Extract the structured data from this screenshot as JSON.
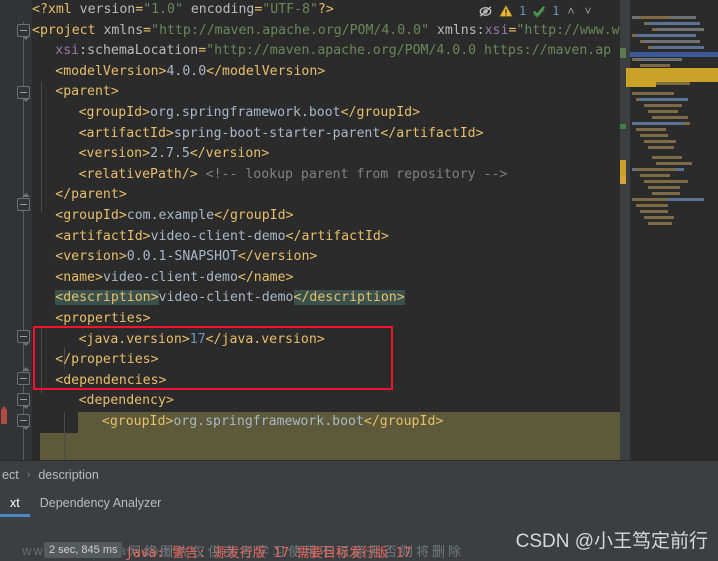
{
  "app": {
    "theme_bg": "#2b2b2b",
    "accent": "#4a88c7",
    "annotation_color": "#f4142e",
    "selection_color": "#5c5a3a"
  },
  "inspector": {
    "eye_off_icon": "inspection-disabled-icon",
    "warning_icon": "warning-triangle-icon",
    "warning_count": "1",
    "check_icon": "green-check-icon",
    "check_count": "1",
    "prev_label": "˄",
    "next_label": "˅"
  },
  "editor": {
    "language": "xml",
    "file": "pom.xml",
    "lines": [
      {
        "indent": 0,
        "html": "<span class=\"pi\">&lt;?</span><span class=\"pi\">xml </span><span class=\"attr\">version</span><span class=\"pi\">=</span><span class=\"attrv\">\"1.0\"</span><span class=\"pi\"> </span><span class=\"attr\">encoding</span><span class=\"pi\">=</span><span class=\"attrv\">\"UTF-8\"</span><span class=\"pi\">?&gt;</span>"
      },
      {
        "indent": 0,
        "html": "<span class=\"tag\">&lt;project </span><span class=\"attr\">xmlns</span><span class=\"tag\">=</span><span class=\"attrv\">\"http://maven.apache.org/POM/4.0.0\"</span><span class=\"tag\"> </span><span class=\"attr\">xmlns:</span><span class=\"ns\">xsi</span><span class=\"tag\">=</span><span class=\"attrv\">\"http://www.w</span>"
      },
      {
        "indent": 1,
        "html": "<span class=\"ns\">xsi</span><span class=\"attr\">:schemaLocation</span><span class=\"tag\">=</span><span class=\"attrv\">\"http://maven.apache.org/POM/4.0.0 https://maven.ap</span>"
      },
      {
        "indent": 1,
        "html": "<span class=\"tag\">&lt;modelVersion&gt;</span><span class=\"val\">4.0.0</span><span class=\"tag\">&lt;/modelVersion&gt;</span>"
      },
      {
        "indent": 1,
        "html": "<span class=\"tag\">&lt;parent&gt;</span>"
      },
      {
        "indent": 2,
        "html": "<span class=\"tag\">&lt;groupId&gt;</span><span class=\"val\">org.springframework.boot</span><span class=\"tag\">&lt;/groupId&gt;</span>"
      },
      {
        "indent": 2,
        "html": "<span class=\"tag\">&lt;artifactId&gt;</span><span class=\"val\">spring-boot-starter-parent</span><span class=\"tag\">&lt;/artifactId&gt;</span>"
      },
      {
        "indent": 2,
        "html": "<span class=\"tag\">&lt;version&gt;</span><span class=\"val\">2.7.5</span><span class=\"tag\">&lt;/version&gt;</span>"
      },
      {
        "indent": 2,
        "html": "<span class=\"tag\">&lt;relativePath/&gt;</span><span class=\"cmt\"> &lt;!-- lookup parent from repository --&gt;</span>"
      },
      {
        "indent": 1,
        "html": "<span class=\"tag\">&lt;/parent&gt;</span>"
      },
      {
        "indent": 1,
        "html": "<span class=\"tag\">&lt;groupId&gt;</span><span class=\"val\">com.example</span><span class=\"tag\">&lt;/groupId&gt;</span>"
      },
      {
        "indent": 1,
        "html": "<span class=\"tag\">&lt;artifactId&gt;</span><span class=\"val\">video-client-demo</span><span class=\"tag\">&lt;/artifactId&gt;</span>"
      },
      {
        "indent": 1,
        "html": "<span class=\"tag\">&lt;version&gt;</span><span class=\"val\">0.0.1-SNAPSHOT</span><span class=\"tag\">&lt;/version&gt;</span>"
      },
      {
        "indent": 1,
        "html": "<span class=\"tag\">&lt;name&gt;</span><span class=\"val\">video-client-demo</span><span class=\"tag\">&lt;/name&gt;</span>"
      },
      {
        "indent": 1,
        "html": "<span class=\"hl tag\">&lt;description&gt;</span><span class=\"val\">video-client-demo</span><span class=\"hl tag\">&lt;/description&gt;</span>"
      },
      {
        "indent": 1,
        "html": "<span class=\"tag\">&lt;properties&gt;</span>"
      },
      {
        "indent": 2,
        "html": "<span class=\"tag\">&lt;java.version&gt;</span><span class=\"num\">17</span><span class=\"tag\">&lt;/java.version&gt;</span>"
      },
      {
        "indent": 1,
        "html": "<span class=\"tag\">&lt;/properties&gt;</span>"
      },
      {
        "indent": 1,
        "html": "<span class=\"tag\">&lt;dependencies&gt;</span>"
      },
      {
        "indent": 2,
        "html": "<span class=\"tag\">&lt;dependency&gt;</span>"
      },
      {
        "indent": 3,
        "html": "<span class=\"tag\">&lt;groupId&gt;</span><span class=\"val\">org.springframework.boot</span><span class=\"tag\">&lt;/groupId&gt;</span>"
      },
      {
        "indent": 3,
        "html": ""
      }
    ]
  },
  "annotation": {
    "shape": "rectangle",
    "target_lines": "properties block"
  },
  "breadcrumb": {
    "items": [
      "ect",
      "description"
    ],
    "separator": "›"
  },
  "tabs": [
    {
      "label": "xt",
      "active": true
    },
    {
      "label": "Dependency Analyzer",
      "active": false
    }
  ],
  "console": {
    "duration": "2 sec, 845 ms",
    "message": "java: 警告: 源发行版 17 需要目标发行版 17",
    "watermark_url": "www.baymchan.com",
    "watermark_cn": "网络图片仅供参考学习使用不可商用否则将删除"
  },
  "watermark": {
    "text": "CSDN @小王笃定前行"
  },
  "minimap": {
    "present": true
  }
}
